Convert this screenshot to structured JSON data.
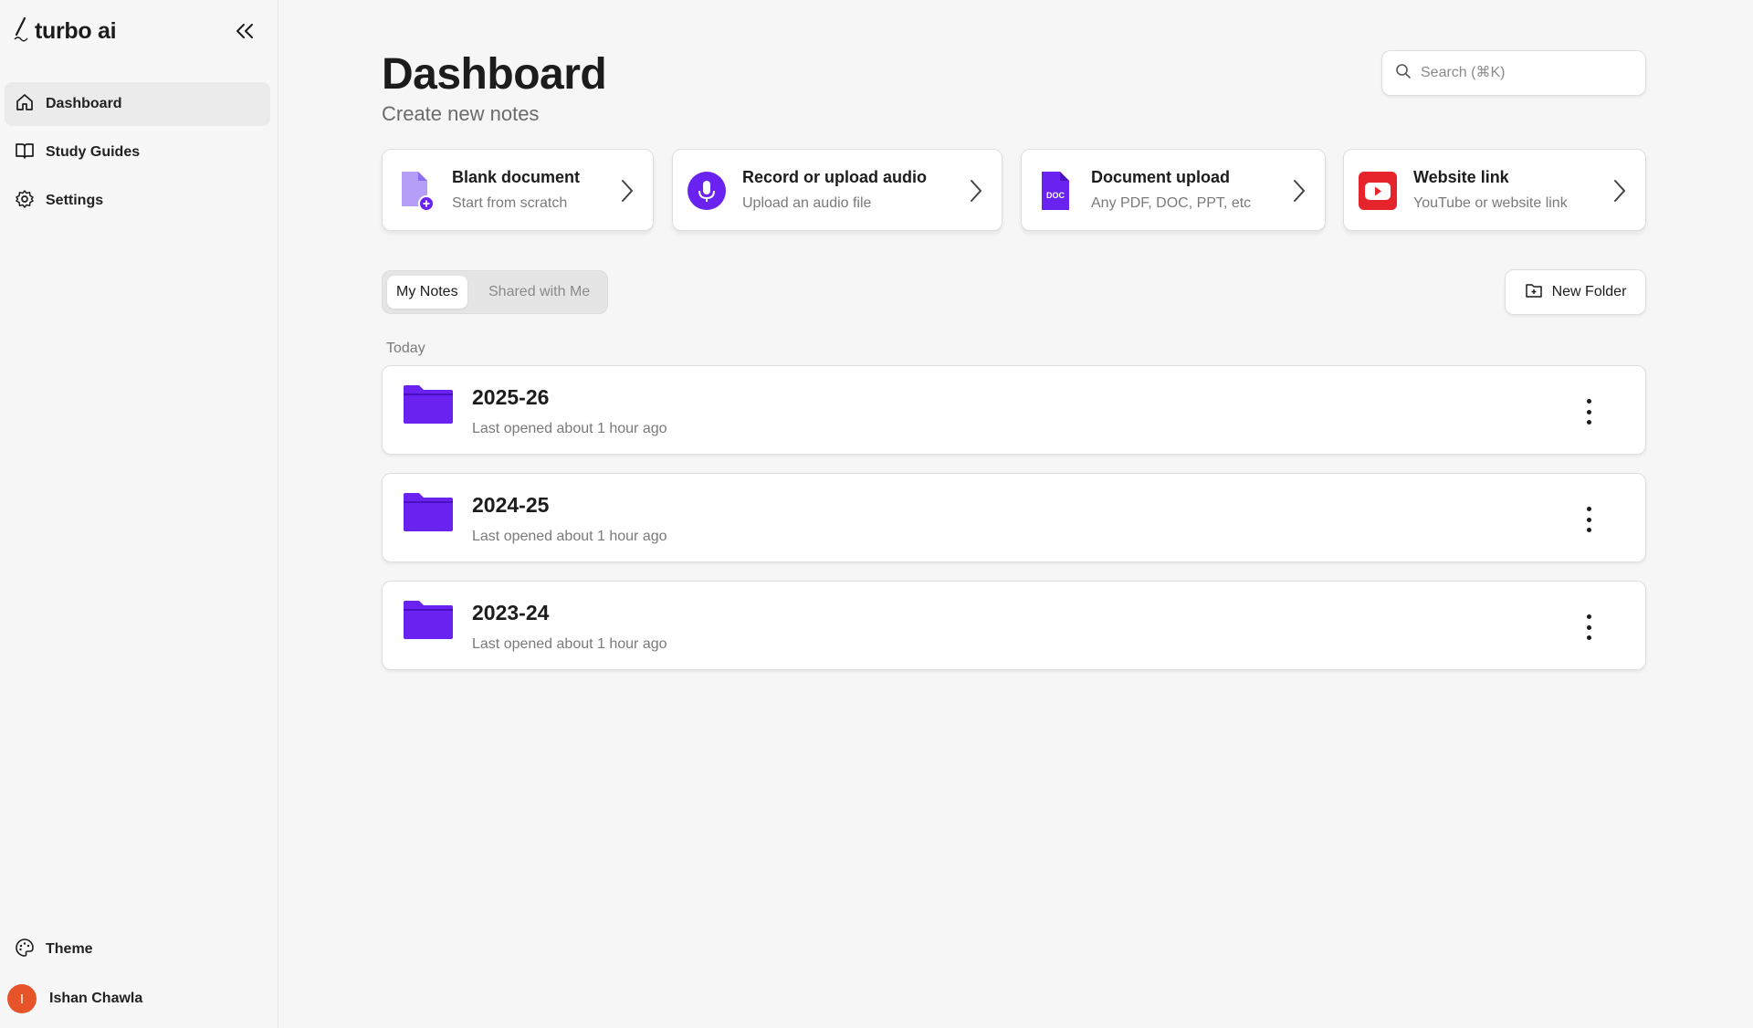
{
  "brand": {
    "name": "turbo ai"
  },
  "sidebar": {
    "items": [
      {
        "label": "Dashboard",
        "icon": "home-icon",
        "active": true
      },
      {
        "label": "Study Guides",
        "icon": "book-icon",
        "active": false
      },
      {
        "label": "Settings",
        "icon": "gear-icon",
        "active": false
      }
    ],
    "theme_label": "Theme",
    "user": {
      "initial": "I",
      "name": "Ishan Chawla"
    }
  },
  "header": {
    "title": "Dashboard",
    "subtitle": "Create new notes",
    "search_placeholder": "Search (⌘K)"
  },
  "create_cards": [
    {
      "title": "Blank document",
      "subtitle": "Start from scratch",
      "icon": "blank-document-icon"
    },
    {
      "title": "Record or upload audio",
      "subtitle": "Upload an audio file",
      "icon": "microphone-icon"
    },
    {
      "title": "Document upload",
      "subtitle": "Any PDF, DOC, PPT, etc",
      "icon": "doc-file-icon"
    },
    {
      "title": "Website link",
      "subtitle": "YouTube or website link",
      "icon": "youtube-icon"
    }
  ],
  "tabs": {
    "my_notes": "My Notes",
    "shared": "Shared with Me"
  },
  "new_folder_label": "New Folder",
  "section_label": "Today",
  "folders": [
    {
      "name": "2025-26",
      "meta": "Last opened about 1 hour ago"
    },
    {
      "name": "2024-25",
      "meta": "Last opened about 1 hour ago"
    },
    {
      "name": "2023-24",
      "meta": "Last opened about 1 hour ago"
    }
  ],
  "colors": {
    "accent": "#6a22f0",
    "youtube": "#e5242b",
    "avatar": "#e8542a"
  }
}
